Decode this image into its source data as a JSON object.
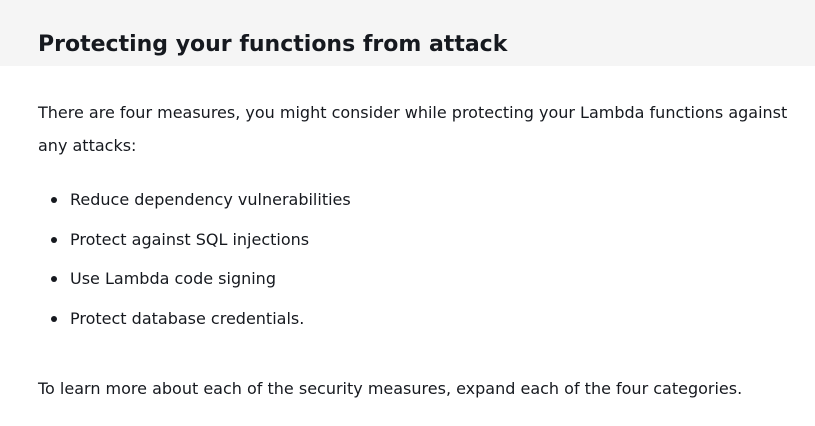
{
  "section": {
    "title": "Protecting your functions from attack",
    "intro": "There are four measures, you might consider while protecting your Lambda functions against any attacks:",
    "measures": [
      "Reduce dependency vulnerabilities",
      "Protect against SQL injections",
      "Use Lambda code signing",
      "Protect database credentials."
    ],
    "outro": "To learn more about each of the security measures, expand each of the four categories."
  }
}
